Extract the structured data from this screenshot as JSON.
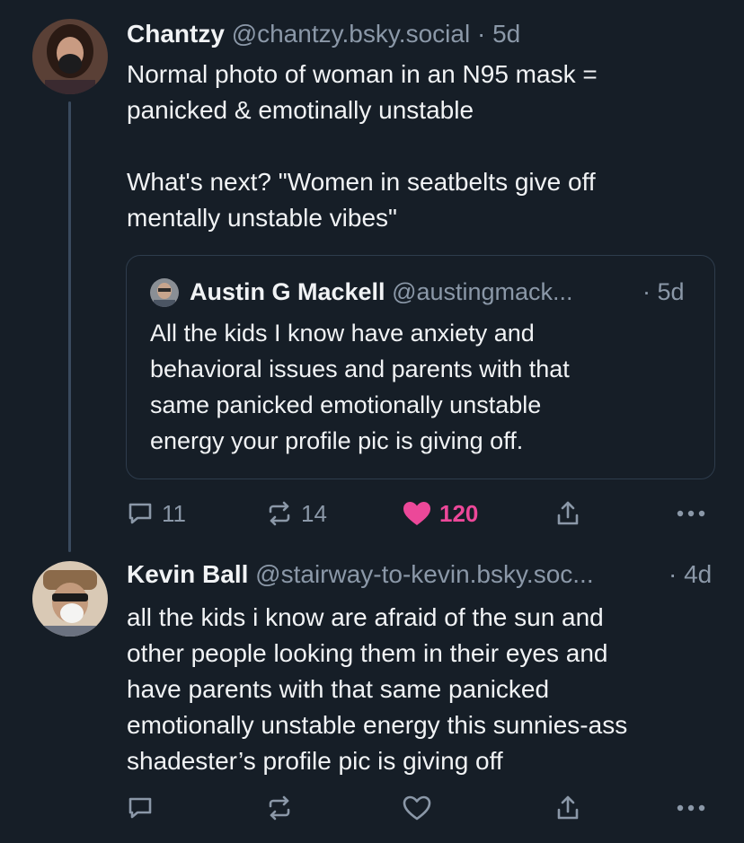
{
  "post1": {
    "author_name": "Chantzy",
    "author_handle": "@chantzy.bsky.social",
    "separator": "·",
    "time": "5d",
    "text_line1": "Normal photo of woman in an N95 mask =",
    "text_line2": "panicked & emotinally unstable",
    "text_line3": "What's next? \"Women in seatbelts give off",
    "text_line4": "mentally unstable vibes\"",
    "quote": {
      "author_name": "Austin G Mackell",
      "author_handle": "@austingmack...",
      "time": "· 5d",
      "text_line1": "All the kids I know have anxiety and",
      "text_line2": "behavioral issues and parents with that",
      "text_line3": "same panicked emotionally unstable",
      "text_line4": "energy your profile pic is giving off."
    },
    "actions": {
      "reply_count": "11",
      "repost_count": "14",
      "like_count": "120",
      "liked": true,
      "like_color": "#ec4899"
    }
  },
  "post2": {
    "author_name": "Kevin Ball",
    "author_handle": "@stairway-to-kevin.bsky.soc...",
    "time": "· 4d",
    "text_line1": "all the kids i know are afraid of the sun and",
    "text_line2": "other people looking them in their eyes and",
    "text_line3": "have parents with that same panicked",
    "text_line4": "emotionally unstable energy this sunnies-ass",
    "text_line5": "shadester’s profile pic is giving off"
  },
  "icons": [
    "reply-icon",
    "repost-icon",
    "heart-icon",
    "share-icon",
    "more-icon"
  ],
  "colors": {
    "background": "#161e27",
    "muted": "#8b98a8",
    "thread_line": "#3a4a5e",
    "like": "#ec4899"
  }
}
